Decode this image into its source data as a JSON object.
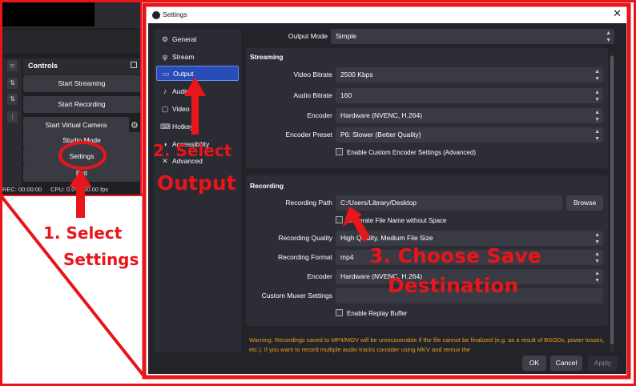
{
  "obs_controls": {
    "title": "Controls",
    "buttons": {
      "start_streaming": "Start Streaming",
      "start_recording": "Start Recording",
      "start_virtual_camera": "Start Virtual Camera",
      "studio_mode": "Studio Mode",
      "settings": "Settings",
      "exit": "Exit"
    },
    "status": {
      "rec": "REC: 00:00:00",
      "cpu": "CPU: 0.0%, 60.00 fps"
    }
  },
  "settings": {
    "window_title": "Settings",
    "close_glyph": "✕",
    "sidebar": [
      {
        "label": "General",
        "icon": "⚙"
      },
      {
        "label": "Stream",
        "icon": "ψ"
      },
      {
        "label": "Output",
        "icon": "▭",
        "active": true
      },
      {
        "label": "Audio",
        "icon": "♪"
      },
      {
        "label": "Video",
        "icon": "▢"
      },
      {
        "label": "Hotkeys",
        "icon": "⌨"
      },
      {
        "label": "Accessibility",
        "icon": "◑"
      },
      {
        "label": "Advanced",
        "icon": "✕"
      }
    ],
    "output_mode": {
      "label": "Output Mode",
      "value": "Simple"
    },
    "streaming": {
      "title": "Streaming",
      "video_bitrate": {
        "label": "Video Bitrate",
        "value": "2500 Kbps"
      },
      "audio_bitrate": {
        "label": "Audio Bitrate",
        "value": "160"
      },
      "encoder": {
        "label": "Encoder",
        "value": "Hardware (NVENC, H.264)"
      },
      "encoder_preset": {
        "label": "Encoder Preset",
        "value": "P6: Slower (Better Quality)"
      },
      "custom_settings": "Enable Custom Encoder Settings (Advanced)"
    },
    "recording": {
      "title": "Recording",
      "path": {
        "label": "Recording Path",
        "value": "C:/Users/Library/Desktop"
      },
      "browse": "Browse",
      "no_space": "Generate File Name without Space",
      "quality": {
        "label": "Recording Quality",
        "value": "High Quality, Medium File Size"
      },
      "format": {
        "label": "Recording Format",
        "value": "mp4"
      },
      "encoder": {
        "label": "Encoder",
        "value": "Hardware (NVENC, H.264)"
      },
      "muxer": {
        "label": "Custom Muxer Settings",
        "value": ""
      },
      "replay_buffer": "Enable Replay Buffer"
    },
    "warning": "Warning: Recordings saved to MP4/MOV will be unrecoverable if the file cannot be finalized (e.g. as a result of BSODs, power losses, etc.). If you want to record multiple audio tracks consider using MKV and remux the",
    "buttons": {
      "ok": "OK",
      "cancel": "Cancel",
      "apply": "Apply"
    }
  },
  "annotations": {
    "step1_line1": "1.  Select",
    "step1_line2": "Settings",
    "step2_line1": "2. Select",
    "step2_line2": "Output",
    "step3_line1": "3. Choose Save",
    "step3_line2": "Destination"
  },
  "colors": {
    "annotation_red": "#e8151b",
    "active_blue": "#284cb8",
    "warning_orange": "#e8a020"
  }
}
